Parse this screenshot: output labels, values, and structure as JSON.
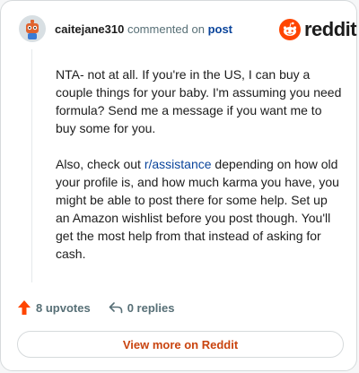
{
  "comment": {
    "author": "caitejane310",
    "action_text": " commented on ",
    "post_link": "post",
    "paragraphs": {
      "p1": "NTA- not at all. If you're in the US, I can buy a couple things for your baby. I'm assuming you need formula? Send me a message if you want me to buy some for you.",
      "p2_before": "Also, check out ",
      "p2_link": "r/assistance",
      "p2_after": " depending on how old your profile is, and how much karma you have, you might be able to post there for some help. Set up an Amazon wishlist before you post though. You'll get the most help from that instead of asking for cash."
    }
  },
  "brand": {
    "wordmark": "reddit",
    "logo_icon": "reddit-snoo-icon",
    "color": "#ff4500"
  },
  "actions": {
    "upvotes": "8 upvotes",
    "replies": "0 replies",
    "upvote_icon": "upvote-arrow-icon",
    "reply_icon": "reply-arrow-icon"
  },
  "view_more": "View more on Reddit",
  "colors": {
    "link": "#0a449b",
    "upvote": "#ff4500",
    "view_more_text": "#c9440f",
    "muted": "#576f76"
  }
}
